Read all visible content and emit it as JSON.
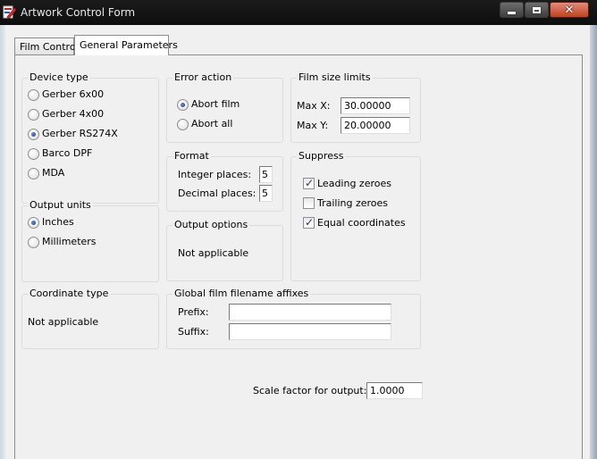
{
  "window": {
    "title": "Artwork Control Form",
    "close_glyph": "✕",
    "icon": "artwork-app-icon"
  },
  "tabs": [
    {
      "label": "Film Control",
      "selected": false
    },
    {
      "label": "General Parameters",
      "selected": true
    }
  ],
  "device_type": {
    "title": "Device type",
    "options": [
      {
        "label": "Gerber 6x00",
        "selected": false
      },
      {
        "label": "Gerber 4x00",
        "selected": false
      },
      {
        "label": "Gerber RS274X",
        "selected": true
      },
      {
        "label": "Barco DPF",
        "selected": false
      },
      {
        "label": "MDA",
        "selected": false
      }
    ]
  },
  "output_units": {
    "title": "Output units",
    "options": [
      {
        "label": "Inches",
        "selected": true
      },
      {
        "label": "Millimeters",
        "selected": false
      }
    ]
  },
  "coordinate_type": {
    "title": "Coordinate type",
    "text": "Not applicable"
  },
  "error_action": {
    "title": "Error action",
    "options": [
      {
        "label": "Abort film",
        "selected": true
      },
      {
        "label": "Abort all",
        "selected": false
      }
    ]
  },
  "format": {
    "title": "Format",
    "integer_label": "Integer places:",
    "integer_value": "5",
    "decimal_label": "Decimal places:",
    "decimal_value": "5"
  },
  "output_options": {
    "title": "Output options",
    "text": "Not applicable"
  },
  "film_size_limits": {
    "title": "Film size limits",
    "max_x_label": "Max X:",
    "max_x_value": "30.00000",
    "max_y_label": "Max Y:",
    "max_y_value": "20.00000"
  },
  "suppress": {
    "title": "Suppress",
    "options": [
      {
        "label": "Leading zeroes",
        "checked": true
      },
      {
        "label": "Trailing zeroes",
        "checked": false
      },
      {
        "label": "Equal coordinates",
        "checked": true
      }
    ]
  },
  "affixes": {
    "title": "Global film filename affixes",
    "prefix_label": "Prefix:",
    "prefix_value": "",
    "suffix_label": "Suffix:",
    "suffix_value": ""
  },
  "scale": {
    "label": "Scale factor for output:",
    "value": "1.0000"
  },
  "glyphs": {
    "check": "✓"
  }
}
